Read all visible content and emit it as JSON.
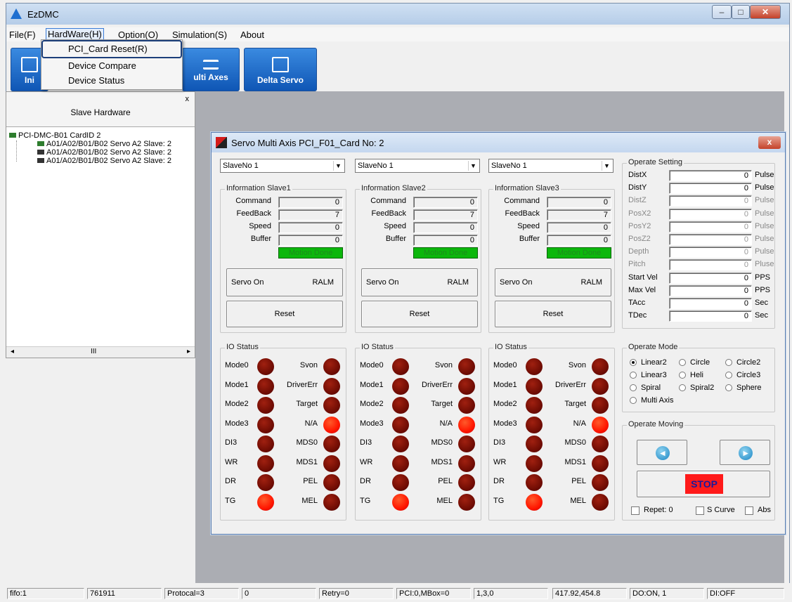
{
  "app": {
    "title": "EzDMC"
  },
  "menu": [
    "File(F)",
    "HardWare(H)",
    "Option(O)",
    "Simulation(S)",
    "About"
  ],
  "hardware_menu": [
    "PCI_Card Reset(R)",
    "Device Compare",
    "Device Status"
  ],
  "toolbar": {
    "init_label": "Ini",
    "multi_axes_label": "ulti Axes",
    "delta_servo_label": "Delta Servo"
  },
  "left_panel": {
    "title": "Slave Hardware",
    "close": "x",
    "root": "PCI-DMC-B01 CardID 2",
    "children": [
      "A01/A02/B01/B02 Servo A2 Slave: 2",
      "A01/A02/B01/B02 Servo A2 Slave: 2",
      "A01/A02/B01/B02 Servo A2 Slave: 2"
    ],
    "scroll_mid": "III"
  },
  "child_window": {
    "title": "Servo Multi Axis PCI_F01_Card No: 2",
    "close": "x"
  },
  "slaves": [
    {
      "select": "SlaveNo 1",
      "group": "Information Slave1",
      "command": "0",
      "feedback": "7",
      "speed": "0",
      "buffer": "0"
    },
    {
      "select": "SlaveNo 1",
      "group": "Information Slave2",
      "command": "0",
      "feedback": "7",
      "speed": "0",
      "buffer": "0"
    },
    {
      "select": "SlaveNo 1",
      "group": "Information Slave3",
      "command": "0",
      "feedback": "7",
      "speed": "0",
      "buffer": "0"
    }
  ],
  "info_labels": {
    "command": "Command",
    "feedback": "FeedBack",
    "speed": "Speed",
    "buffer": "Buffer",
    "motion_done": "Motion Done"
  },
  "buttons": {
    "servo_on": "Servo On",
    "ralm": "RALM",
    "reset": "Reset"
  },
  "io": {
    "title": "IO Status",
    "left": [
      "Mode0",
      "Mode1",
      "Mode2",
      "Mode3",
      "DI3",
      "WR",
      "DR",
      "TG"
    ],
    "right": [
      "Svon",
      "DriverErr",
      "Target",
      "N/A",
      "MDS0",
      "MDS1",
      "PEL",
      "MEL"
    ],
    "left_on": [
      false,
      false,
      false,
      false,
      false,
      false,
      false,
      true
    ],
    "right_on": [
      false,
      false,
      false,
      true,
      false,
      false,
      false,
      false
    ]
  },
  "operate_setting": {
    "title": "Operate Setting",
    "rows": [
      {
        "label": "DistX",
        "value": "0",
        "unit": "Pulse",
        "enabled": true
      },
      {
        "label": "DistY",
        "value": "0",
        "unit": "Pulse",
        "enabled": true
      },
      {
        "label": "DistZ",
        "value": "0",
        "unit": "Pulse",
        "enabled": false
      },
      {
        "label": "PosX2",
        "value": "0",
        "unit": "Pulse",
        "enabled": false
      },
      {
        "label": "PosY2",
        "value": "0",
        "unit": "Pulse",
        "enabled": false
      },
      {
        "label": "PosZ2",
        "value": "0",
        "unit": "Pulse",
        "enabled": false
      },
      {
        "label": "Depth",
        "value": "0",
        "unit": "Pulse",
        "enabled": false
      },
      {
        "label": "Pitch",
        "value": "0",
        "unit": "Pluse",
        "enabled": false
      },
      {
        "label": "Start Vel",
        "value": "0",
        "unit": "PPS",
        "enabled": true
      },
      {
        "label": "Max Vel",
        "value": "0",
        "unit": "PPS",
        "enabled": true
      },
      {
        "label": "TAcc",
        "value": "0",
        "unit": "Sec",
        "enabled": true
      },
      {
        "label": "TDec",
        "value": "0",
        "unit": "Sec",
        "enabled": true
      }
    ]
  },
  "operate_mode": {
    "title": "Operate Mode",
    "options": [
      "Linear2",
      "Circle",
      "Circle2",
      "Linear3",
      "Heli",
      "Circle3",
      "Spiral",
      "Spiral2",
      "Sphere",
      "Multi Axis"
    ],
    "selected": "Linear2"
  },
  "operate_moving": {
    "title": "Operate Moving",
    "stop": "STOP",
    "repeat": "Repet: 0",
    "scurve": "S Curve",
    "abs": "Abs"
  },
  "status_bar": [
    "fifo:1",
    "761911",
    "Protocal=3",
    "0",
    "Retry=0",
    "PCI:0,MBox=0",
    "1,3,0",
    "417.92,454.8",
    "DO:ON, 1",
    "DI:OFF"
  ],
  "colors": {
    "motion_done": "#0cb70c",
    "led_on": "#ff1600",
    "led_off": "#6a0a02",
    "stop_bg": "#ff1a1a",
    "toolbar_blue": "#1060c0"
  }
}
